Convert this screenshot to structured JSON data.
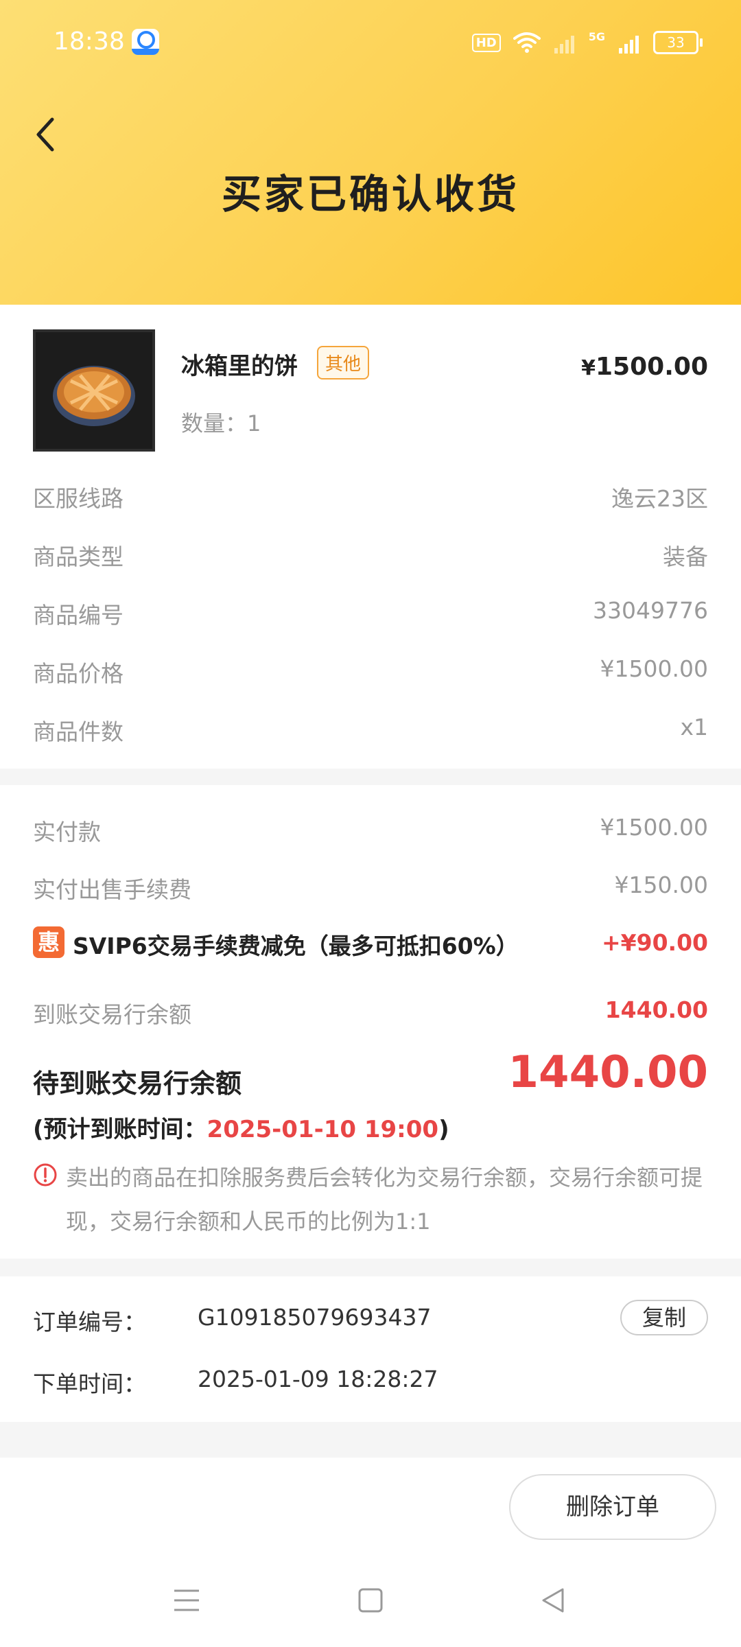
{
  "status_bar": {
    "time": "18:38",
    "hd_label": "HD",
    "network_label": "5G",
    "battery": "33"
  },
  "header": {
    "title": "买家已确认收货"
  },
  "product": {
    "name": "冰箱里的饼",
    "tag": "其他",
    "price_symbol": "¥",
    "price_value": "1500.00",
    "quantity_label": "数量：",
    "quantity_value": "1"
  },
  "details": [
    {
      "label": "区服线路",
      "value": "逸云23区"
    },
    {
      "label": "商品类型",
      "value": "装备"
    },
    {
      "label": "商品编号",
      "value": "33049776"
    },
    {
      "label": "商品价格",
      "value": "¥1500.00"
    },
    {
      "label": "商品件数",
      "value": "x1"
    }
  ],
  "payment": {
    "paid": {
      "label": "实付款",
      "value": "¥1500.00"
    },
    "fee": {
      "label": "实付出售手续费",
      "value": "¥150.00"
    },
    "discount": {
      "badge": "惠",
      "label": "SVIP6交易手续费减免（最多可抵扣60%）",
      "value": "+¥90.00"
    },
    "received": {
      "label": "到账交易行余额",
      "value": "1440.00"
    },
    "pending": {
      "label": "待到账交易行余额",
      "value": "1440.00"
    },
    "eta": {
      "prefix": "(预计到账时间：",
      "time": "2025-01-10 19:00",
      "suffix": ")"
    },
    "notice": "卖出的商品在扣除服务费后会转化为交易行余额，交易行余额可提现，交易行余额和人民币的比例为1:1"
  },
  "order": {
    "number_label": "订单编号：",
    "number_value": "G109185079693437",
    "copy_label": "复制",
    "time_label": "下单时间：",
    "time_value": "2025-01-09 18:28:27"
  },
  "actions": {
    "delete_label": "删除订单"
  },
  "colors": {
    "header_start": "#fddf74",
    "header_end": "#fdc52a",
    "accent_red": "#e84545",
    "tag_orange": "#f5a53b",
    "hui_orange": "#f36a33"
  }
}
